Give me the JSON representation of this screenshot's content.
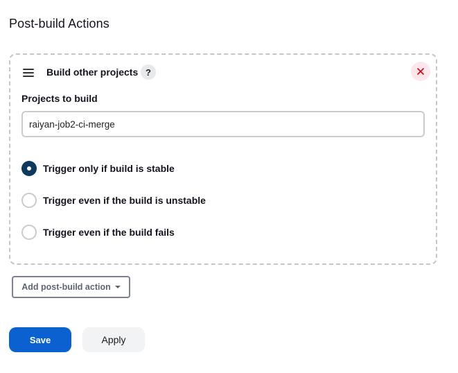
{
  "section": {
    "title": "Post-build Actions"
  },
  "card": {
    "title": "Build other projects",
    "help_icon": "question-icon",
    "help_label": "?",
    "close_icon": "close-icon",
    "drag_icon": "drag-handle-icon",
    "projects_label": "Projects to build",
    "projects_value": "raiyan-job2-ci-merge",
    "options": [
      {
        "label": "Trigger only if build is stable",
        "checked": true
      },
      {
        "label": "Trigger even if the build is unstable",
        "checked": false
      },
      {
        "label": "Trigger even if the build fails",
        "checked": false
      }
    ]
  },
  "add_action": {
    "label": "Add post-build action",
    "icon": "caret-down-icon"
  },
  "buttons": {
    "save_label": "Save",
    "apply_label": "Apply"
  },
  "colors": {
    "primary": "#0b61d0",
    "radio_checked": "#0d3a5c",
    "close_bg": "#fde7ea",
    "close_x": "#d0021b"
  }
}
